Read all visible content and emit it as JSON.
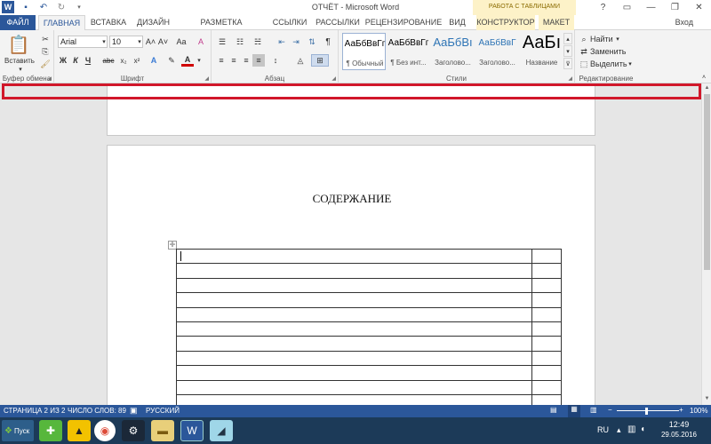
{
  "window": {
    "title": "ОТЧЁТ - Microsoft Word",
    "context_group": "РАБОТА С ТАБЛИЦАМИ",
    "login": "Вход"
  },
  "tabs": [
    "ФАЙЛ",
    "ГЛАВНАЯ",
    "ВСТАВКА",
    "ДИЗАЙН",
    "РАЗМЕТКА СТРАНИЦЫ",
    "ССЫЛКИ",
    "РАССЫЛКИ",
    "РЕЦЕНЗИРОВАНИЕ",
    "ВИД",
    "КОНСТРУКТОР",
    "МАКЕТ"
  ],
  "ribbon": {
    "clipboard": {
      "label": "Буфер обмена",
      "paste": "Вставить"
    },
    "font": {
      "label": "Шрифт",
      "name": "Arial",
      "size": "10",
      "bold": "Ж",
      "italic": "К",
      "underline": "Ч",
      "strike": "abc",
      "sub": "x₂",
      "sup": "x²",
      "grow": "A˄",
      "shrink": "A˅",
      "case": "Aa",
      "color_a": "A",
      "clear": "A"
    },
    "paragraph": {
      "label": "Абзац",
      "pilcrow": "¶"
    },
    "styles": {
      "label": "Стили",
      "items": [
        {
          "preview": "АаБбВвГг",
          "name": "¶ Обычный"
        },
        {
          "preview": "АаБбВвГг",
          "name": "¶ Без инт..."
        },
        {
          "preview": "АаБбВı",
          "name": "Заголово..."
        },
        {
          "preview": "АаБбВвГ",
          "name": "Заголово..."
        },
        {
          "preview": "АаБı",
          "name": "Название"
        }
      ]
    },
    "editing": {
      "label": "Редактирование",
      "find": "Найти",
      "replace": "Заменить",
      "select": "Выделить"
    }
  },
  "document": {
    "heading": "СОДЕРЖАНИЕ",
    "table_rows": 11
  },
  "status": {
    "page": "СТРАНИЦА 2 ИЗ 2",
    "words": "ЧИСЛО СЛОВ: 89",
    "lang": "РУССКИЙ",
    "zoom": "100%",
    "zoom_minus": "−",
    "zoom_plus": "+"
  },
  "taskbar": {
    "start": "Пуск",
    "lang": "RU",
    "time": "12:49",
    "date": "29.05.2016"
  },
  "colors": {
    "accent": "#2b579a",
    "highlight": "#d1172a",
    "font_color": "#d00000"
  }
}
